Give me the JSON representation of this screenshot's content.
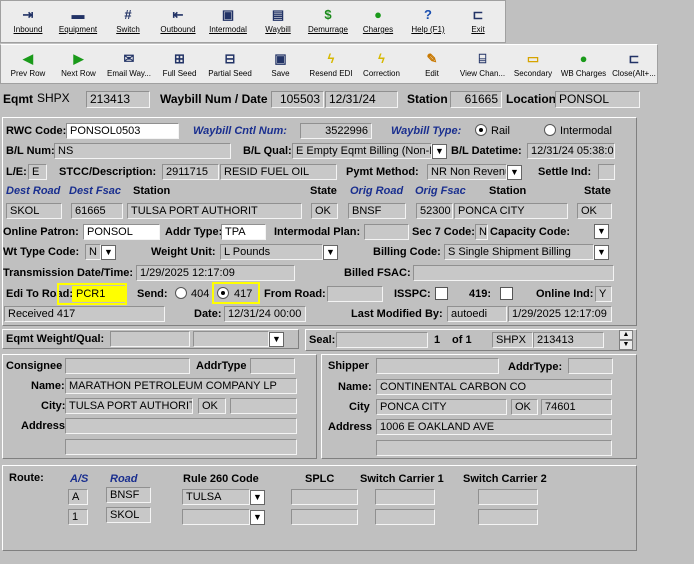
{
  "toolbar1": [
    {
      "label": "Inbound",
      "icon": "inbound-icon",
      "glyph": "⇥"
    },
    {
      "label": "Equipment",
      "icon": "railcar-icon",
      "glyph": "▬"
    },
    {
      "label": "Switch",
      "icon": "track-icon",
      "glyph": "#"
    },
    {
      "label": "Outbound",
      "icon": "outbound-icon",
      "glyph": "⇤"
    },
    {
      "label": "Intermodal",
      "icon": "intermodal-icon",
      "glyph": "▣"
    },
    {
      "label": "Waybill",
      "icon": "waybill-icon",
      "glyph": "▤"
    },
    {
      "label": "Demurrage",
      "icon": "dollar-icon",
      "glyph": "$"
    },
    {
      "label": "Charges",
      "icon": "moneybag-icon",
      "glyph": "●"
    },
    {
      "label": "Help (F1)",
      "icon": "help-icon",
      "glyph": "?"
    },
    {
      "label": "Exit",
      "icon": "exit-door-icon",
      "glyph": "⊏"
    }
  ],
  "toolbar2": [
    {
      "label": "Prev Row",
      "icon": "left-arrow-icon",
      "glyph": "◀"
    },
    {
      "label": "Next Row",
      "icon": "right-arrow-icon",
      "glyph": "▶"
    },
    {
      "label": "Email Way...",
      "icon": "email-icon",
      "glyph": "✉"
    },
    {
      "label": "Full Seed",
      "icon": "full-seed-icon",
      "glyph": "⊞"
    },
    {
      "label": "Partial Seed",
      "icon": "partial-seed-icon",
      "glyph": "⊟"
    },
    {
      "label": "Save",
      "icon": "save-icon",
      "glyph": "▣"
    },
    {
      "label": "Resend EDI",
      "icon": "lightning-icon",
      "glyph": "ϟ"
    },
    {
      "label": "Correction",
      "icon": "lightning-icon",
      "glyph": "ϟ"
    },
    {
      "label": "Edit",
      "icon": "edit-icon",
      "glyph": "✎"
    },
    {
      "label": "View Chan...",
      "icon": "view-changes-icon",
      "glyph": "⌸"
    },
    {
      "label": "Secondary",
      "icon": "folder-icon",
      "glyph": "▭"
    },
    {
      "label": "WB Charges",
      "icon": "moneybag-icon",
      "glyph": "●"
    },
    {
      "label": "Close(Alt+...",
      "icon": "close-door-icon",
      "glyph": "⊏"
    }
  ],
  "header": {
    "eqmt_label": "Eqmt",
    "eqmt_init": "SHPX",
    "eqmt_num": "213413",
    "waybill_label": "Waybill Num / Date",
    "waybill_num": "105503",
    "waybill_date": "12/31/24",
    "station_label": "Station",
    "station_code": "61665",
    "location_label": "Location",
    "location": "PONSOL"
  },
  "main": {
    "rwc_label": "RWC Code:",
    "rwc_value": "PONSOL0503",
    "wb_cntl_label": "Waybill Cntl Num:",
    "wb_cntl_value": "3522996",
    "wb_type_label": "Waybill Type:",
    "wb_type_rail": "Rail",
    "wb_type_intermodal": "Intermodal",
    "bl_num_label": "B/L Num:",
    "bl_num_value": "NS",
    "bl_qual_label": "B/L Qual:",
    "bl_qual_value": "E Empty Eqmt Billing (Non-Re",
    "bl_datetime_label": "B/L Datetime:",
    "bl_datetime_value": "12/31/24 05:38:00",
    "le_label": "L/E:",
    "le_value": "E",
    "stcc_label": "STCC/Description:",
    "stcc_value": "2911715",
    "stcc_desc": "RESID FUEL OIL",
    "pymt_label": "Pymt Method:",
    "pymt_value": "NR Non Revenu",
    "settle_label": "Settle Ind:",
    "dest_road_label": "Dest Road",
    "dest_fsac_label": "Dest Fsac",
    "station_hdr": "Station",
    "state_hdr": "State",
    "orig_road_label": "Orig Road",
    "orig_fsac_label": "Orig Fsac",
    "station_hdr2": "Station",
    "state_hdr2": "State",
    "dest_road": "SKOL",
    "dest_fsac": "61665",
    "dest_station": "TULSA PORT AUTHORIT",
    "dest_state": "OK",
    "orig_road": "BNSF",
    "orig_fsac": "52300",
    "orig_station": "PONCA CITY",
    "orig_state": "OK",
    "online_patron_label": "Online Patron:",
    "online_patron_value": "PONSOL",
    "addr_type_label": "Addr Type:",
    "addr_type_value": "TPA",
    "intermodal_plan_label": "Intermodal Plan:",
    "sec7_label": "Sec 7 Code:",
    "sec7_value": "N",
    "capacity_label": "Capacity Code:",
    "wt_type_label": "Wt Type Code:",
    "wt_type_value": "N",
    "weight_unit_label": "Weight Unit:",
    "weight_unit_value": "L Pounds",
    "billing_code_label": "Billing Code:",
    "billing_code_value": "S Single Shipment Billing",
    "trans_label": "Transmission Date/Time:",
    "trans_value": "1/29/2025 12:17:09",
    "billed_fsac_label": "Billed FSAC:",
    "edi_road_label": "Edi To Road:",
    "edi_road_value": "PCR1",
    "send_label": "Send:",
    "send_404": "404",
    "send_417": "417",
    "from_road_label": "From Road:",
    "isspc_label": "ISSPC:",
    "r419_label": "419:",
    "online_ind_label": "Online Ind:",
    "online_ind_value": "Y",
    "received": "Received 417",
    "date_label": "Date:",
    "date_value": "12/31/24 00:00",
    "last_mod_label": "Last Modified By:",
    "last_mod_user": "autoedi",
    "last_mod_time": "1/29/2025 12:17:09"
  },
  "weight": {
    "label": "Eqmt Weight/Qual:"
  },
  "seal": {
    "label": "Seal:",
    "index": "1",
    "of": "of 1",
    "init": "SHPX",
    "num": "213413"
  },
  "consignee": {
    "label": "Consignee",
    "addr_type_label": "AddrType",
    "name_label": "Name:",
    "name": "MARATHON PETROLEUM COMPANY LP",
    "city_label": "City:",
    "city": "TULSA PORT AUTHORIT",
    "state": "OK",
    "address_label": "Address"
  },
  "shipper": {
    "label": "Shipper",
    "addr_type_label": "AddrType:",
    "name_label": "Name:",
    "name": "CONTINENTAL CARBON CO",
    "city_label": "City",
    "city": "PONCA CITY",
    "state": "OK",
    "zip": "74601",
    "address_label": "Address",
    "address": "1006 E OAKLAND AVE"
  },
  "route": {
    "label": "Route:",
    "as_hdr": "A/S",
    "road_hdr": "Road",
    "rule_hdr": "Rule 260 Code",
    "splc_hdr": "SPLC",
    "sw1_hdr": "Switch Carrier 1",
    "sw2_hdr": "Switch Carrier 2",
    "rows": [
      {
        "as": "A",
        "road": "BNSF",
        "rule": "TULSA"
      },
      {
        "as": "1",
        "road": "SKOL",
        "rule": ""
      }
    ]
  }
}
